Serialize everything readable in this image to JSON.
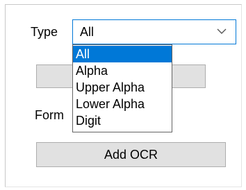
{
  "form": {
    "type_label": "Type",
    "format_label_visible": "Forma",
    "add_ocr_label": "Add OCR"
  },
  "type_select": {
    "selected_value": "All",
    "options": [
      "All",
      "Alpha",
      "Upper Alpha",
      "Lower Alpha",
      "Digit"
    ],
    "highlighted_option": "All"
  },
  "colors": {
    "accent": "#0078d7",
    "button_face": "#e1e1e1",
    "button_border": "#adadad"
  },
  "icons": {
    "dropdown": "chevron-down-icon"
  }
}
